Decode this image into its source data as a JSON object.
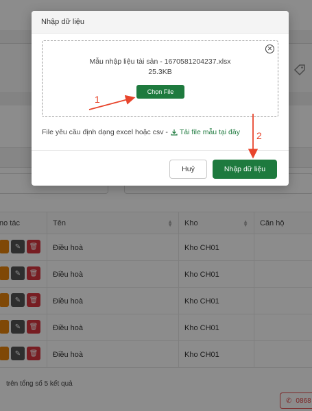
{
  "background": {
    "table": {
      "headers": [
        "no tác",
        "Tên",
        "Kho",
        "Căn hộ"
      ],
      "rows": [
        {
          "name": "Điều hoà",
          "kho": "Kho CH01",
          "canho": ""
        },
        {
          "name": "Điều hoà",
          "kho": "Kho CH01",
          "canho": ""
        },
        {
          "name": "Điều hoà",
          "kho": "Kho CH01",
          "canho": ""
        },
        {
          "name": "Điều hoà",
          "kho": "Kho CH01",
          "canho": ""
        },
        {
          "name": "Điều hoà",
          "kho": "Kho CH01",
          "canho": ""
        }
      ]
    },
    "footer_text": "trên tổng số 5 kết quả",
    "phone_text": "0868"
  },
  "modal": {
    "title": "Nhập dữ liệu",
    "file_name": "Mẫu nhập liệu tài sản - 1670581204237.xlsx",
    "file_size": "25.3KB",
    "choose_file_label": "Chọn File",
    "requirement_text": "File yêu cầu định dạng excel hoặc csv -",
    "download_template_label": "Tải file mẫu tại đây",
    "cancel_label": "Huỷ",
    "import_label": "Nhập dữ liệu"
  },
  "annotations": {
    "step1": "1",
    "step2": "2"
  },
  "colors": {
    "primary_green": "#1e7a3e",
    "danger_red": "#d9363e",
    "annotation_red": "#e8452c"
  }
}
